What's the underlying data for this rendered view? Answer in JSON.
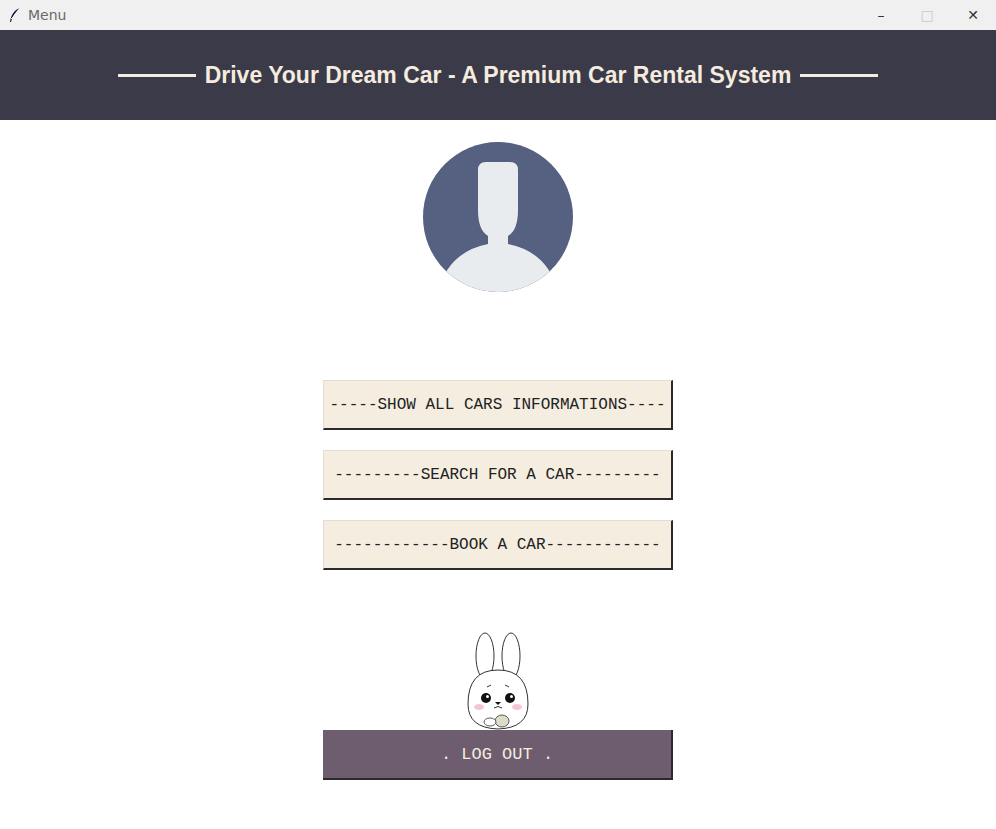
{
  "window": {
    "title": "Menu",
    "controls": [
      {
        "label": "–",
        "disabled": false
      },
      {
        "label": "□",
        "disabled": true
      },
      {
        "label": "✕",
        "disabled": false
      }
    ]
  },
  "header": {
    "title": "Drive Your Dream Car - A Premium Car Rental System"
  },
  "menu_buttons": [
    "-----SHOW ALL CARS INFORMATIONS----",
    "---------SEARCH FOR A CAR---------",
    "------------BOOK A CAR------------"
  ],
  "logout_button": ". LOG OUT ."
}
